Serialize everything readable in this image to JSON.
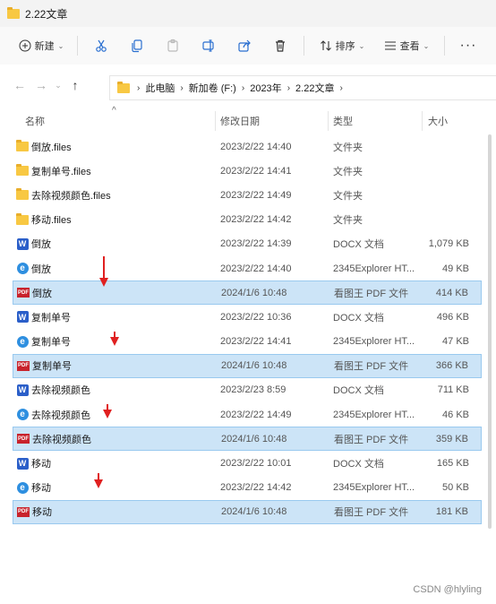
{
  "window": {
    "title": "2.22文章"
  },
  "toolbar": {
    "new_label": "新建",
    "sort_label": "排序",
    "view_label": "查看",
    "more_label": "···"
  },
  "address": {
    "crumbs": [
      "此电脑",
      "新加卷 (F:)",
      "2023年",
      "2.22文章"
    ]
  },
  "columns": {
    "name": "名称",
    "date": "修改日期",
    "type": "类型",
    "size": "大小"
  },
  "files": [
    {
      "icon": "folder-icon",
      "name": "倒放.files",
      "date": "2023/2/22 14:40",
      "type": "文件夹",
      "size": "",
      "selected": false
    },
    {
      "icon": "folder-icon",
      "name": "复制单号.files",
      "date": "2023/2/22 14:41",
      "type": "文件夹",
      "size": "",
      "selected": false
    },
    {
      "icon": "folder-icon",
      "name": "去除视频颜色.files",
      "date": "2023/2/22 14:49",
      "type": "文件夹",
      "size": "",
      "selected": false
    },
    {
      "icon": "folder-icon",
      "name": "移动.files",
      "date": "2023/2/22 14:42",
      "type": "文件夹",
      "size": "",
      "selected": false
    },
    {
      "icon": "word-icon",
      "name": "倒放",
      "date": "2023/2/22 14:39",
      "type": "DOCX 文档",
      "size": "1,079 KB",
      "selected": false
    },
    {
      "icon": "browser-icon",
      "name": "倒放",
      "date": "2023/2/22 14:40",
      "type": "2345Explorer HT...",
      "size": "49 KB",
      "selected": false
    },
    {
      "icon": "pdf-icon",
      "name": "倒放",
      "date": "2024/1/6 10:48",
      "type": "看图王 PDF 文件",
      "size": "414 KB",
      "selected": true
    },
    {
      "icon": "word-icon",
      "name": "复制单号",
      "date": "2023/2/22 10:36",
      "type": "DOCX 文档",
      "size": "496 KB",
      "selected": false
    },
    {
      "icon": "browser-icon",
      "name": "复制单号",
      "date": "2023/2/22 14:41",
      "type": "2345Explorer HT...",
      "size": "47 KB",
      "selected": false
    },
    {
      "icon": "pdf-icon",
      "name": "复制单号",
      "date": "2024/1/6 10:48",
      "type": "看图王 PDF 文件",
      "size": "366 KB",
      "selected": true
    },
    {
      "icon": "word-icon",
      "name": "去除视频颜色",
      "date": "2023/2/23 8:59",
      "type": "DOCX 文档",
      "size": "711 KB",
      "selected": false
    },
    {
      "icon": "browser-icon",
      "name": "去除视频颜色",
      "date": "2023/2/22 14:49",
      "type": "2345Explorer HT...",
      "size": "46 KB",
      "selected": false
    },
    {
      "icon": "pdf-icon",
      "name": "去除视频颜色",
      "date": "2024/1/6 10:48",
      "type": "看图王 PDF 文件",
      "size": "359 KB",
      "selected": true
    },
    {
      "icon": "word-icon",
      "name": "移动",
      "date": "2023/2/22 10:01",
      "type": "DOCX 文档",
      "size": "165 KB",
      "selected": false
    },
    {
      "icon": "browser-icon",
      "name": "移动",
      "date": "2023/2/22 14:42",
      "type": "2345Explorer HT...",
      "size": "50 KB",
      "selected": false
    },
    {
      "icon": "pdf-icon",
      "name": "移动",
      "date": "2024/1/6 10:48",
      "type": "看图王 PDF 文件",
      "size": "181 KB",
      "selected": true
    }
  ],
  "watermark": "CSDN @hlyling",
  "colors": {
    "selection": "#cce4f7",
    "arrow": "#e02020",
    "folder": "#f8c843",
    "word": "#2b5fc9",
    "pdf": "#c8232c"
  }
}
